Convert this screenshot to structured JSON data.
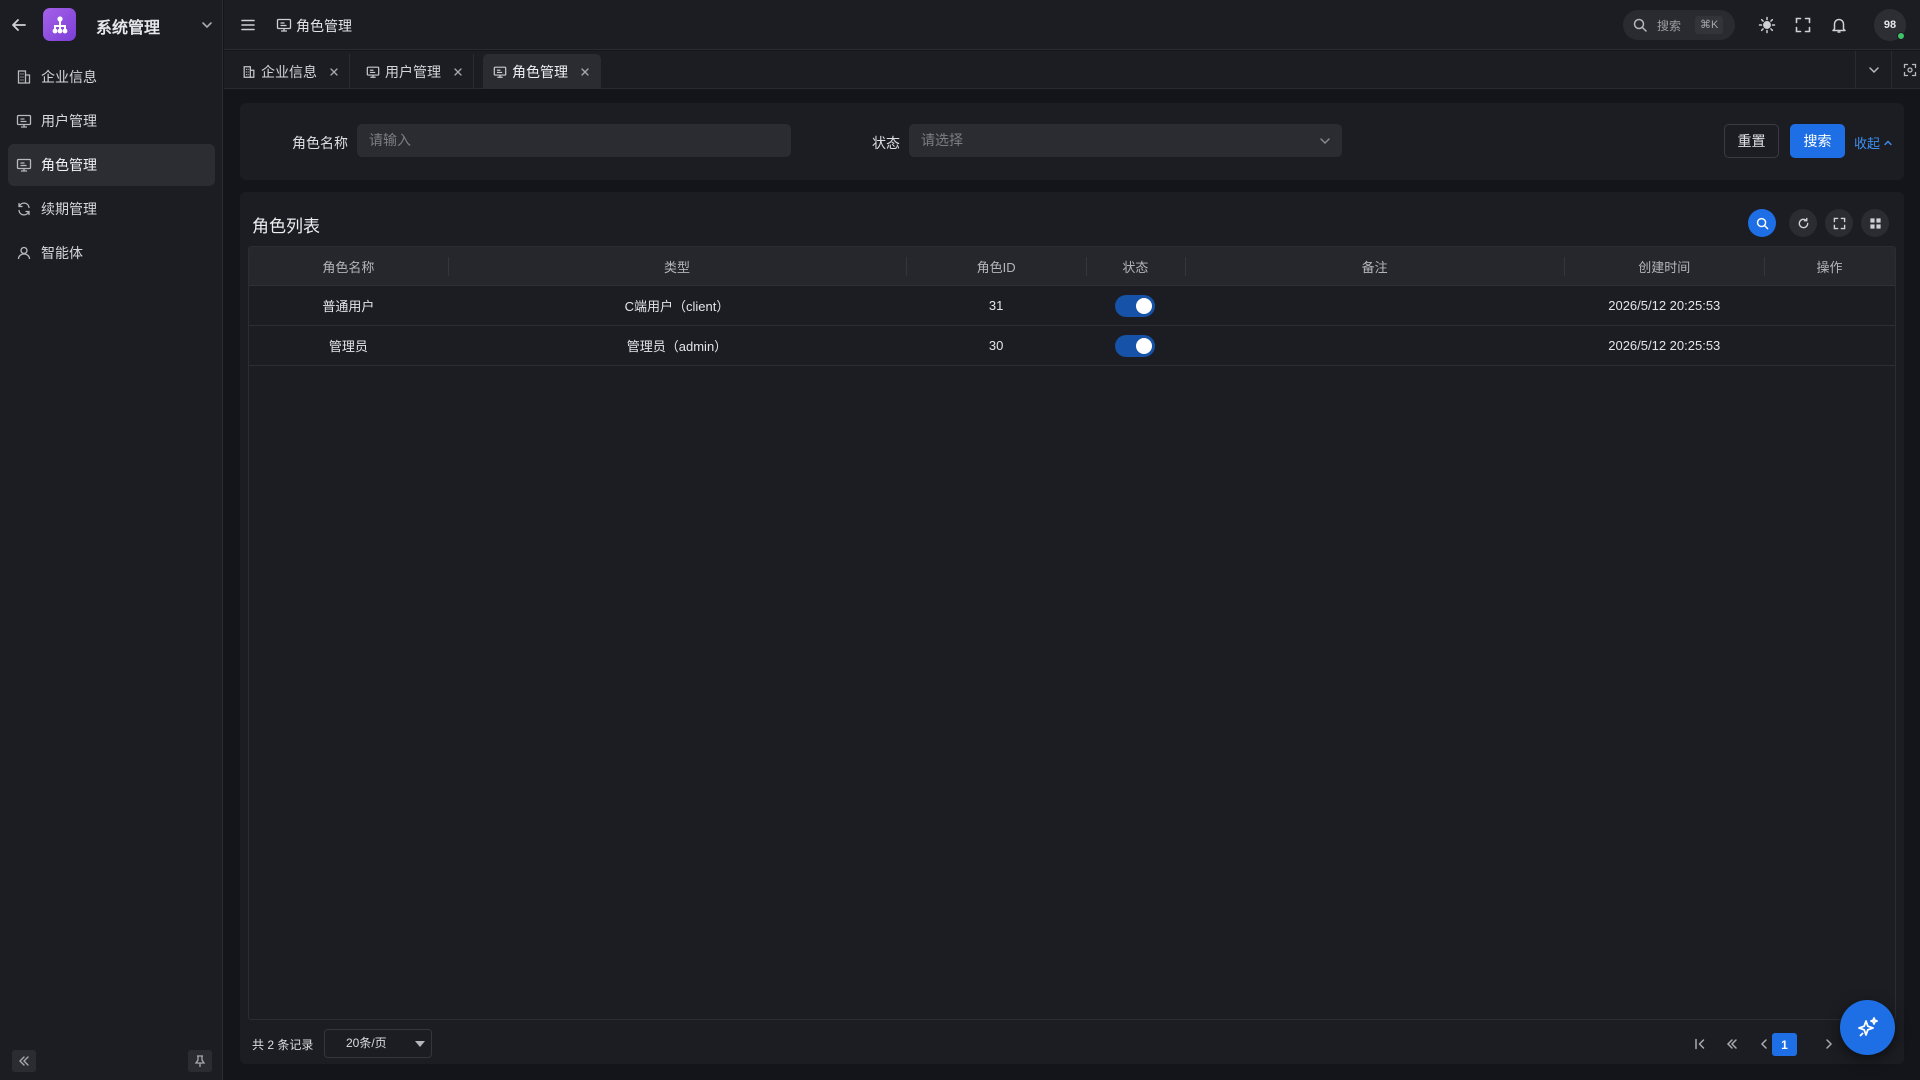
{
  "sidebar": {
    "title": "系统管理",
    "items": [
      {
        "label": "企业信息",
        "icon": "building-icon"
      },
      {
        "label": "用户管理",
        "icon": "monitor-icon"
      },
      {
        "label": "角色管理",
        "icon": "monitor-icon",
        "active": true
      },
      {
        "label": "续期管理",
        "icon": "refresh-icon"
      },
      {
        "label": "智能体",
        "icon": "user-icon"
      }
    ]
  },
  "header": {
    "breadcrumb": "角色管理",
    "search_label": "搜索",
    "search_shortcut": "⌘K",
    "avatar_text": "98"
  },
  "tabs": [
    {
      "label": "企业信息"
    },
    {
      "label": "用户管理"
    },
    {
      "label": "角色管理",
      "active": true
    }
  ],
  "search_form": {
    "role_name_label": "角色名称",
    "role_name_placeholder": "请输入",
    "status_label": "状态",
    "status_placeholder": "请选择",
    "reset_label": "重置",
    "search_label": "搜索",
    "collapse_label": "收起"
  },
  "table": {
    "title": "角色列表",
    "columns": [
      "角色名称",
      "类型",
      "角色ID",
      "状态",
      "备注",
      "创建时间",
      "操作"
    ],
    "rows": [
      {
        "name": "普通用户",
        "type": "C端用户（client）",
        "id": "31",
        "status": true,
        "remark": "",
        "created": "2026/5/12 20:25:53",
        "actions": ""
      },
      {
        "name": "管理员",
        "type": "管理员（admin）",
        "id": "30",
        "status": true,
        "remark": "",
        "created": "2026/5/12 20:25:53",
        "actions": ""
      }
    ]
  },
  "pagination": {
    "total_text": "共 2 条记录",
    "page_size": "20条/页",
    "current_page": "1"
  },
  "colors": {
    "primary": "#1e6fe6",
    "background": "#14151a",
    "panel": "#1c1d22",
    "logo": "#9b57e6"
  }
}
